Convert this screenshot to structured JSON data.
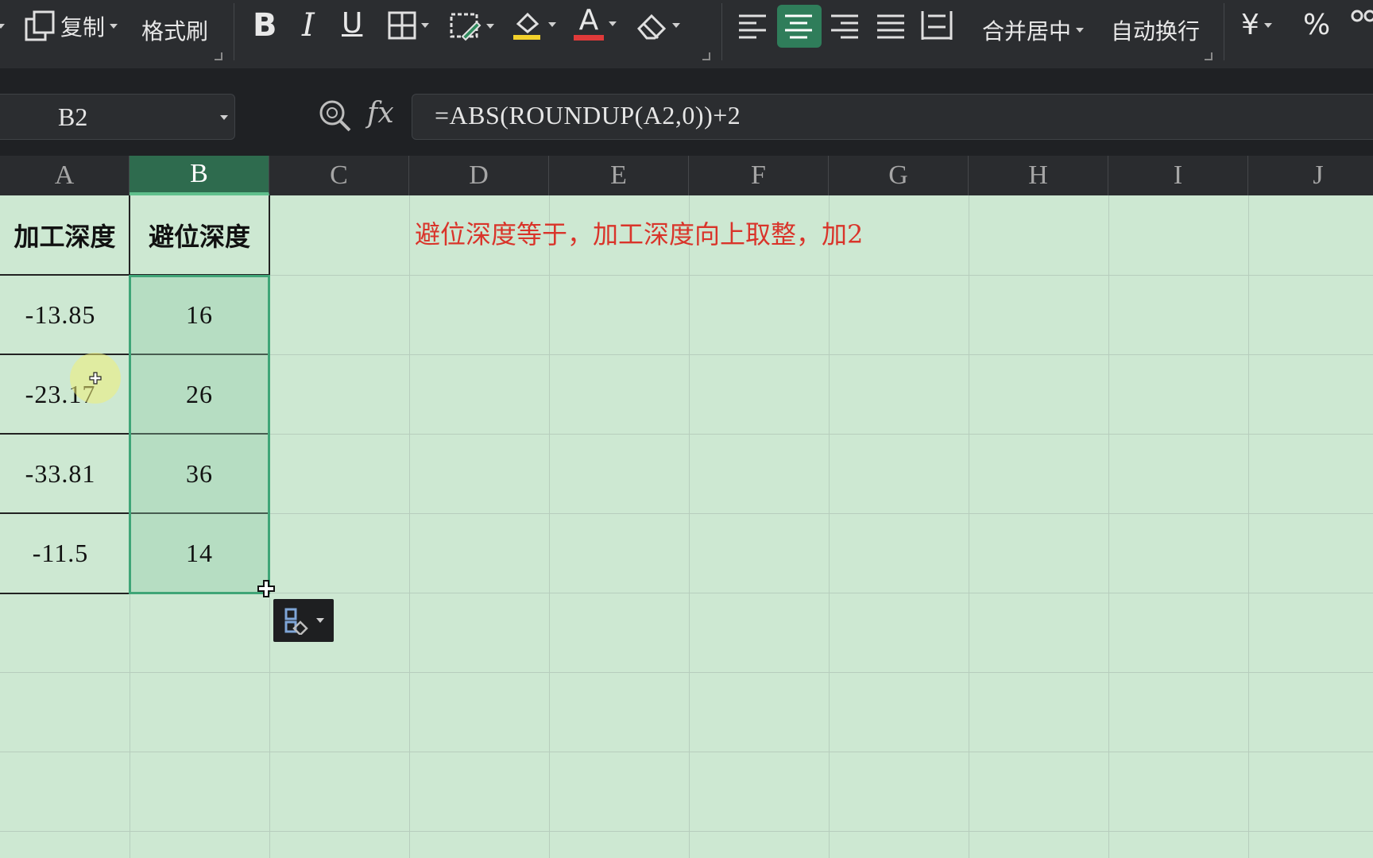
{
  "ribbon": {
    "copy_label": "复制",
    "format_painter_label": "格式刷",
    "bold_glyph": "B",
    "italic_glyph": "I",
    "underline_glyph": "U",
    "font_color_glyph": "A",
    "merge_center_label": "合并居中",
    "wrap_text_label": "自动换行",
    "currency_glyph": "¥",
    "percent_glyph": "%",
    "font_color_bar": "#e03a3a",
    "fill_color_bar": "#f3d12b",
    "active_align": "center"
  },
  "formula_bar": {
    "name_box": "B2",
    "fx_label": "fx",
    "formula": "=ABS(ROUNDUP(A2,0))+2"
  },
  "columns": [
    "A",
    "B",
    "C",
    "D",
    "E",
    "F",
    "G",
    "H",
    "I",
    "J"
  ],
  "selected_column": "B",
  "sheet": {
    "header_a": "加工深度",
    "header_b": "避位深度",
    "note": "避位深度等于，加工深度向上取整，加2",
    "rows": [
      {
        "a": "-13.85",
        "b": "16"
      },
      {
        "a": "-23.17",
        "b": "26"
      },
      {
        "a": "-33.81",
        "b": "36"
      },
      {
        "a": "-11.5",
        "b": "14"
      }
    ]
  }
}
